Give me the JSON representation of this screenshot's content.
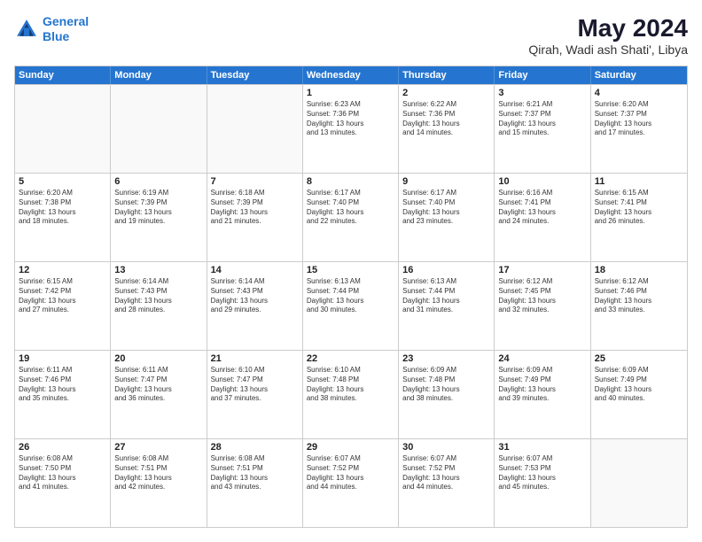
{
  "logo": {
    "line1": "General",
    "line2": "Blue"
  },
  "title": "May 2024",
  "location": "Qirah, Wadi ash Shati', Libya",
  "days_of_week": [
    "Sunday",
    "Monday",
    "Tuesday",
    "Wednesday",
    "Thursday",
    "Friday",
    "Saturday"
  ],
  "weeks": [
    [
      {
        "day": "",
        "sunrise": "",
        "sunset": "",
        "daylight": "",
        "empty": true
      },
      {
        "day": "",
        "sunrise": "",
        "sunset": "",
        "daylight": "",
        "empty": true
      },
      {
        "day": "",
        "sunrise": "",
        "sunset": "",
        "daylight": "",
        "empty": true
      },
      {
        "day": "1",
        "sunrise": "Sunrise: 6:23 AM",
        "sunset": "Sunset: 7:36 PM",
        "daylight": "Daylight: 13 hours",
        "daylight2": "and 13 minutes.",
        "empty": false
      },
      {
        "day": "2",
        "sunrise": "Sunrise: 6:22 AM",
        "sunset": "Sunset: 7:36 PM",
        "daylight": "Daylight: 13 hours",
        "daylight2": "and 14 minutes.",
        "empty": false
      },
      {
        "day": "3",
        "sunrise": "Sunrise: 6:21 AM",
        "sunset": "Sunset: 7:37 PM",
        "daylight": "Daylight: 13 hours",
        "daylight2": "and 15 minutes.",
        "empty": false
      },
      {
        "day": "4",
        "sunrise": "Sunrise: 6:20 AM",
        "sunset": "Sunset: 7:37 PM",
        "daylight": "Daylight: 13 hours",
        "daylight2": "and 17 minutes.",
        "empty": false
      }
    ],
    [
      {
        "day": "5",
        "sunrise": "Sunrise: 6:20 AM",
        "sunset": "Sunset: 7:38 PM",
        "daylight": "Daylight: 13 hours",
        "daylight2": "and 18 minutes.",
        "empty": false
      },
      {
        "day": "6",
        "sunrise": "Sunrise: 6:19 AM",
        "sunset": "Sunset: 7:39 PM",
        "daylight": "Daylight: 13 hours",
        "daylight2": "and 19 minutes.",
        "empty": false
      },
      {
        "day": "7",
        "sunrise": "Sunrise: 6:18 AM",
        "sunset": "Sunset: 7:39 PM",
        "daylight": "Daylight: 13 hours",
        "daylight2": "and 21 minutes.",
        "empty": false
      },
      {
        "day": "8",
        "sunrise": "Sunrise: 6:17 AM",
        "sunset": "Sunset: 7:40 PM",
        "daylight": "Daylight: 13 hours",
        "daylight2": "and 22 minutes.",
        "empty": false
      },
      {
        "day": "9",
        "sunrise": "Sunrise: 6:17 AM",
        "sunset": "Sunset: 7:40 PM",
        "daylight": "Daylight: 13 hours",
        "daylight2": "and 23 minutes.",
        "empty": false
      },
      {
        "day": "10",
        "sunrise": "Sunrise: 6:16 AM",
        "sunset": "Sunset: 7:41 PM",
        "daylight": "Daylight: 13 hours",
        "daylight2": "and 24 minutes.",
        "empty": false
      },
      {
        "day": "11",
        "sunrise": "Sunrise: 6:15 AM",
        "sunset": "Sunset: 7:41 PM",
        "daylight": "Daylight: 13 hours",
        "daylight2": "and 26 minutes.",
        "empty": false
      }
    ],
    [
      {
        "day": "12",
        "sunrise": "Sunrise: 6:15 AM",
        "sunset": "Sunset: 7:42 PM",
        "daylight": "Daylight: 13 hours",
        "daylight2": "and 27 minutes.",
        "empty": false
      },
      {
        "day": "13",
        "sunrise": "Sunrise: 6:14 AM",
        "sunset": "Sunset: 7:43 PM",
        "daylight": "Daylight: 13 hours",
        "daylight2": "and 28 minutes.",
        "empty": false
      },
      {
        "day": "14",
        "sunrise": "Sunrise: 6:14 AM",
        "sunset": "Sunset: 7:43 PM",
        "daylight": "Daylight: 13 hours",
        "daylight2": "and 29 minutes.",
        "empty": false
      },
      {
        "day": "15",
        "sunrise": "Sunrise: 6:13 AM",
        "sunset": "Sunset: 7:44 PM",
        "daylight": "Daylight: 13 hours",
        "daylight2": "and 30 minutes.",
        "empty": false
      },
      {
        "day": "16",
        "sunrise": "Sunrise: 6:13 AM",
        "sunset": "Sunset: 7:44 PM",
        "daylight": "Daylight: 13 hours",
        "daylight2": "and 31 minutes.",
        "empty": false
      },
      {
        "day": "17",
        "sunrise": "Sunrise: 6:12 AM",
        "sunset": "Sunset: 7:45 PM",
        "daylight": "Daylight: 13 hours",
        "daylight2": "and 32 minutes.",
        "empty": false
      },
      {
        "day": "18",
        "sunrise": "Sunrise: 6:12 AM",
        "sunset": "Sunset: 7:46 PM",
        "daylight": "Daylight: 13 hours",
        "daylight2": "and 33 minutes.",
        "empty": false
      }
    ],
    [
      {
        "day": "19",
        "sunrise": "Sunrise: 6:11 AM",
        "sunset": "Sunset: 7:46 PM",
        "daylight": "Daylight: 13 hours",
        "daylight2": "and 35 minutes.",
        "empty": false
      },
      {
        "day": "20",
        "sunrise": "Sunrise: 6:11 AM",
        "sunset": "Sunset: 7:47 PM",
        "daylight": "Daylight: 13 hours",
        "daylight2": "and 36 minutes.",
        "empty": false
      },
      {
        "day": "21",
        "sunrise": "Sunrise: 6:10 AM",
        "sunset": "Sunset: 7:47 PM",
        "daylight": "Daylight: 13 hours",
        "daylight2": "and 37 minutes.",
        "empty": false
      },
      {
        "day": "22",
        "sunrise": "Sunrise: 6:10 AM",
        "sunset": "Sunset: 7:48 PM",
        "daylight": "Daylight: 13 hours",
        "daylight2": "and 38 minutes.",
        "empty": false
      },
      {
        "day": "23",
        "sunrise": "Sunrise: 6:09 AM",
        "sunset": "Sunset: 7:48 PM",
        "daylight": "Daylight: 13 hours",
        "daylight2": "and 38 minutes.",
        "empty": false
      },
      {
        "day": "24",
        "sunrise": "Sunrise: 6:09 AM",
        "sunset": "Sunset: 7:49 PM",
        "daylight": "Daylight: 13 hours",
        "daylight2": "and 39 minutes.",
        "empty": false
      },
      {
        "day": "25",
        "sunrise": "Sunrise: 6:09 AM",
        "sunset": "Sunset: 7:49 PM",
        "daylight": "Daylight: 13 hours",
        "daylight2": "and 40 minutes.",
        "empty": false
      }
    ],
    [
      {
        "day": "26",
        "sunrise": "Sunrise: 6:08 AM",
        "sunset": "Sunset: 7:50 PM",
        "daylight": "Daylight: 13 hours",
        "daylight2": "and 41 minutes.",
        "empty": false
      },
      {
        "day": "27",
        "sunrise": "Sunrise: 6:08 AM",
        "sunset": "Sunset: 7:51 PM",
        "daylight": "Daylight: 13 hours",
        "daylight2": "and 42 minutes.",
        "empty": false
      },
      {
        "day": "28",
        "sunrise": "Sunrise: 6:08 AM",
        "sunset": "Sunset: 7:51 PM",
        "daylight": "Daylight: 13 hours",
        "daylight2": "and 43 minutes.",
        "empty": false
      },
      {
        "day": "29",
        "sunrise": "Sunrise: 6:07 AM",
        "sunset": "Sunset: 7:52 PM",
        "daylight": "Daylight: 13 hours",
        "daylight2": "and 44 minutes.",
        "empty": false
      },
      {
        "day": "30",
        "sunrise": "Sunrise: 6:07 AM",
        "sunset": "Sunset: 7:52 PM",
        "daylight": "Daylight: 13 hours",
        "daylight2": "and 44 minutes.",
        "empty": false
      },
      {
        "day": "31",
        "sunrise": "Sunrise: 6:07 AM",
        "sunset": "Sunset: 7:53 PM",
        "daylight": "Daylight: 13 hours",
        "daylight2": "and 45 minutes.",
        "empty": false
      },
      {
        "day": "",
        "sunrise": "",
        "sunset": "",
        "daylight": "",
        "daylight2": "",
        "empty": true
      }
    ]
  ]
}
